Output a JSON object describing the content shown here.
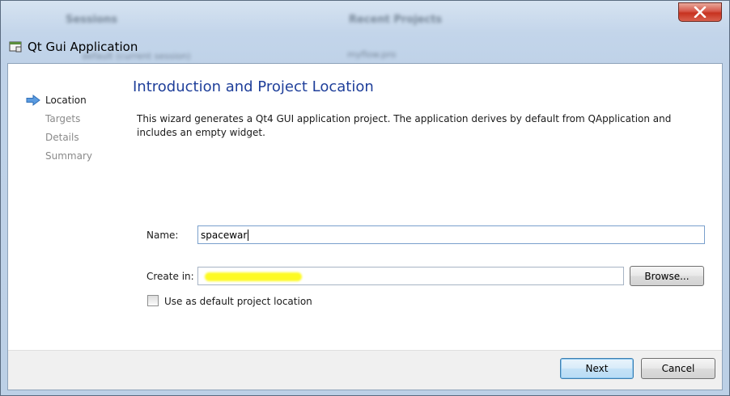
{
  "background": {
    "left_heading": "Sessions",
    "right_heading": "Recent Projects",
    "left_item": "default (current session)",
    "right_item": "myflow.pro"
  },
  "window": {
    "title": "Qt Gui Application"
  },
  "wizard": {
    "steps": [
      {
        "label": "Location",
        "active": true
      },
      {
        "label": "Targets",
        "active": false
      },
      {
        "label": "Details",
        "active": false
      },
      {
        "label": "Summary",
        "active": false
      }
    ],
    "page_title": "Introduction and Project Location",
    "description": "This wizard generates a Qt4 GUI application project. The application derives by default from QApplication and includes an empty widget.",
    "name_label": "Name:",
    "name_value": "spacewar",
    "create_in_label": "Create in:",
    "create_in_value": "",
    "browse_label": "Browse...",
    "default_location_label": "Use as default project location",
    "default_location_checked": false
  },
  "footer": {
    "next_label": "Next",
    "cancel_label": "Cancel"
  },
  "colors": {
    "accent": "#1f3f9a",
    "redaction": "#fdfa22",
    "close_button": "#c7321f"
  }
}
